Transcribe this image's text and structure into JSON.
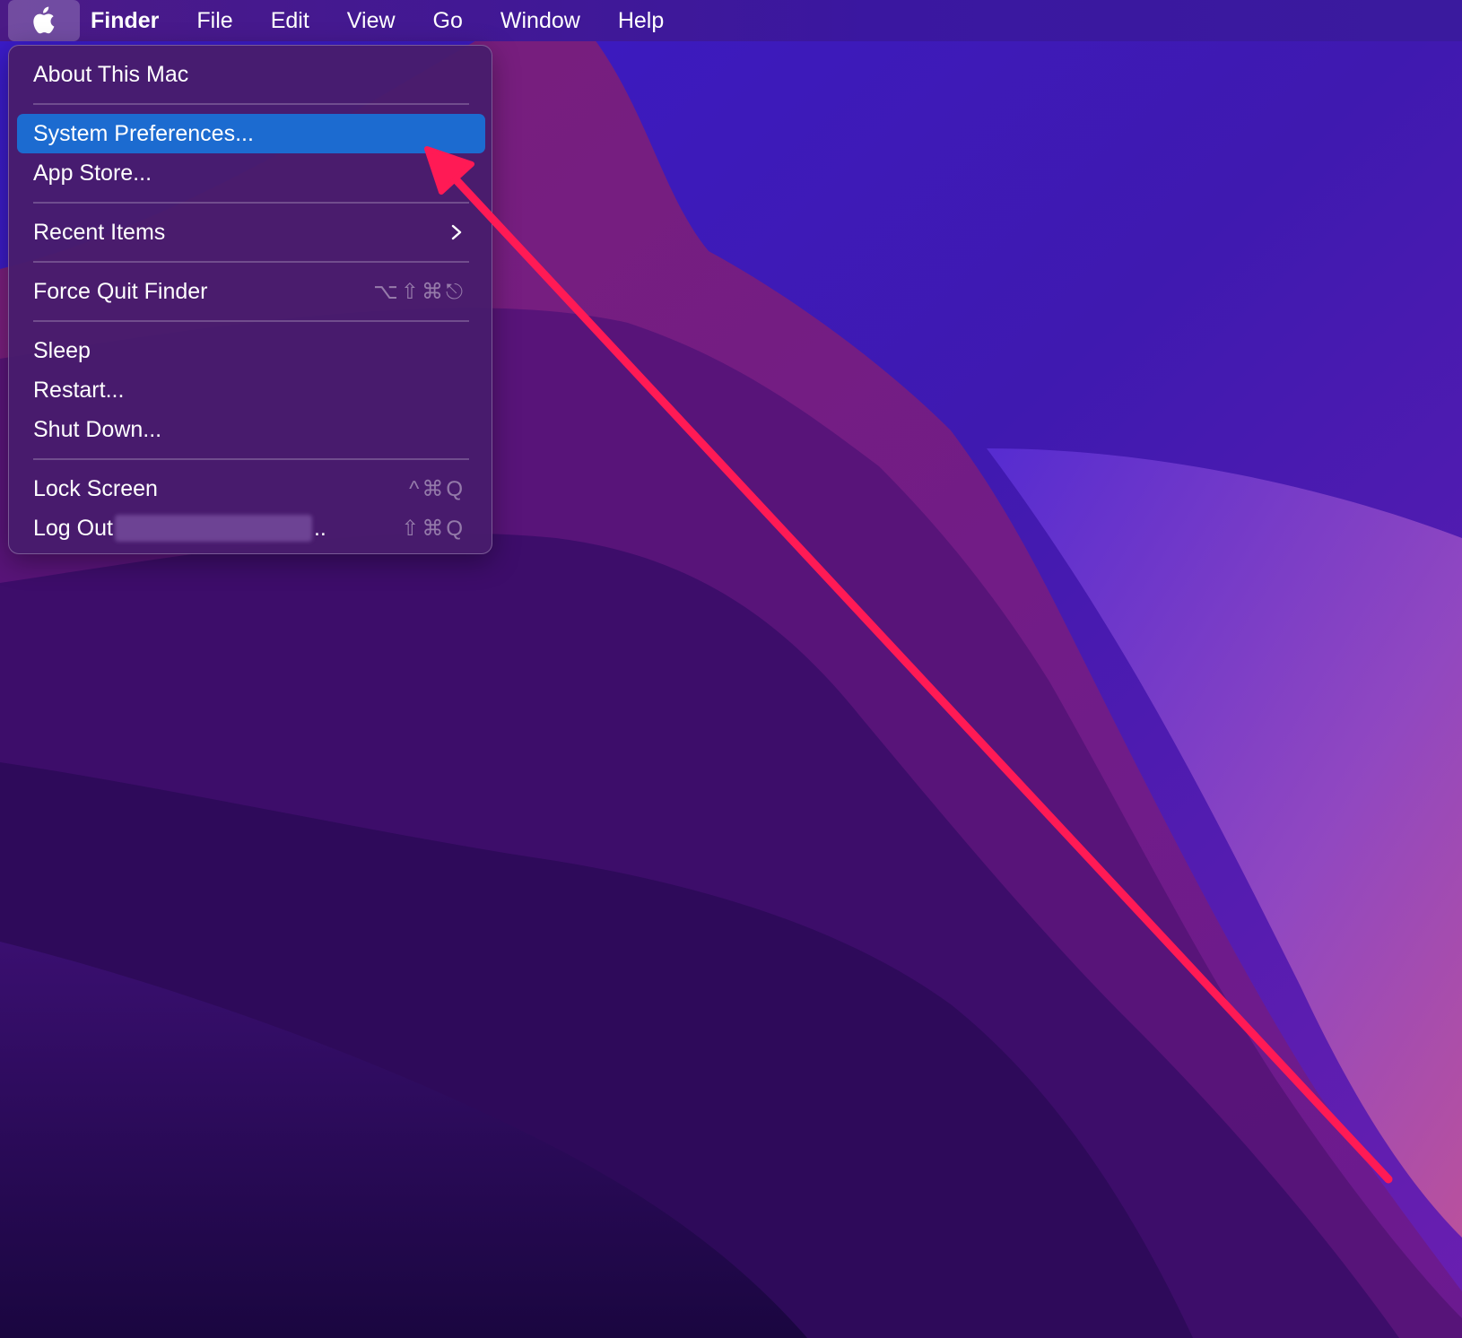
{
  "menubar": {
    "apple_icon": "apple-logo-icon",
    "app_name": "Finder",
    "items": [
      "File",
      "Edit",
      "View",
      "Go",
      "Window",
      "Help"
    ]
  },
  "apple_menu": {
    "about": "About This Mac",
    "system_preferences": "System Preferences...",
    "app_store": "App Store...",
    "recent_items": "Recent Items",
    "recent_items_icon": "chevron-right-icon",
    "force_quit": "Force Quit Finder",
    "force_quit_shortcut": "⌥⇧⌘⎋",
    "sleep": "Sleep",
    "restart": "Restart...",
    "shut_down": "Shut Down...",
    "lock_screen": "Lock Screen",
    "lock_screen_shortcut": "^⌘Q",
    "log_out": "Log Out",
    "log_out_suffix": "..",
    "log_out_shortcut": "⇧⌘Q"
  },
  "annotation": {
    "arrow_color": "#ff1a55",
    "arrow_icon": "annotation-arrow"
  },
  "colors": {
    "highlight": "#1c6bd0",
    "menu_background": "#481c6c"
  }
}
